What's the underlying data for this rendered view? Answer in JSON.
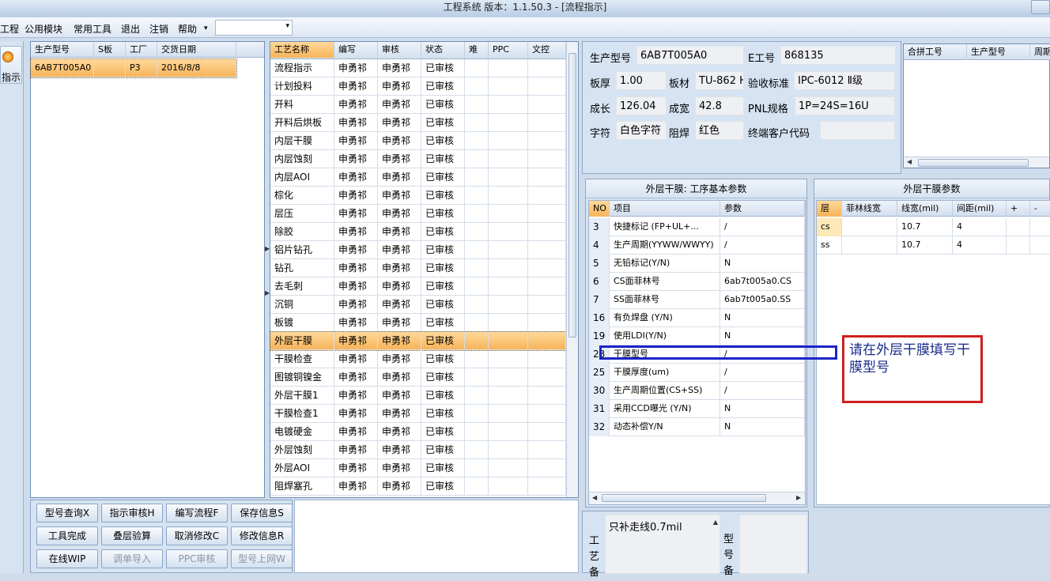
{
  "window": {
    "title": "工程系统   版本：1.1.50.3 - [流程指示]"
  },
  "menu": {
    "items": [
      "工程",
      "公用模块",
      "常用工具",
      "退出",
      "注销",
      "帮助"
    ],
    "help_arrow": "▾",
    "combo_value": "",
    "combo_arrow": "▾"
  },
  "left_strip": {
    "button_label": "指示"
  },
  "orders": {
    "headers": [
      "生产型号",
      "S板",
      "工厂",
      "交货日期"
    ],
    "rows": [
      [
        "6AB7T005A0",
        "",
        "P3",
        "2016/8/8"
      ]
    ]
  },
  "process": {
    "headers": [
      "工艺名称",
      "编写",
      "审核",
      "状态",
      "难",
      "PPC",
      "文控"
    ],
    "rows": [
      [
        "流程指示",
        "申勇祁",
        "申勇祁",
        "已审核"
      ],
      [
        "计划投料",
        "申勇祁",
        "申勇祁",
        "已审核"
      ],
      [
        "开料",
        "申勇祁",
        "申勇祁",
        "已审核"
      ],
      [
        "开料后烘板",
        "申勇祁",
        "申勇祁",
        "已审核"
      ],
      [
        "内层干膜",
        "申勇祁",
        "申勇祁",
        "已审核"
      ],
      [
        "内层蚀刻",
        "申勇祁",
        "申勇祁",
        "已审核"
      ],
      [
        "内层AOI",
        "申勇祁",
        "申勇祁",
        "已审核"
      ],
      [
        "棕化",
        "申勇祁",
        "申勇祁",
        "已审核"
      ],
      [
        "层压",
        "申勇祁",
        "申勇祁",
        "已审核"
      ],
      [
        "除胶",
        "申勇祁",
        "申勇祁",
        "已审核"
      ],
      [
        "铝片钻孔",
        "申勇祁",
        "申勇祁",
        "已审核"
      ],
      [
        "钻孔",
        "申勇祁",
        "申勇祁",
        "已审核"
      ],
      [
        "去毛刺",
        "申勇祁",
        "申勇祁",
        "已审核"
      ],
      [
        "沉铜",
        "申勇祁",
        "申勇祁",
        "已审核"
      ],
      [
        "板镀",
        "申勇祁",
        "申勇祁",
        "已审核"
      ],
      [
        "外层干膜",
        "申勇祁",
        "申勇祁",
        "已审核"
      ],
      [
        "干膜检查",
        "申勇祁",
        "申勇祁",
        "已审核"
      ],
      [
        "图镀铜镍金",
        "申勇祁",
        "申勇祁",
        "已审核"
      ],
      [
        "外层干膜1",
        "申勇祁",
        "申勇祁",
        "已审核"
      ],
      [
        "干膜检查1",
        "申勇祁",
        "申勇祁",
        "已审核"
      ],
      [
        "电镀硬金",
        "申勇祁",
        "申勇祁",
        "已审核"
      ],
      [
        "外层蚀刻",
        "申勇祁",
        "申勇祁",
        "已审核"
      ],
      [
        "外层AOI",
        "申勇祁",
        "申勇祁",
        "已审核"
      ],
      [
        "阻焊塞孔",
        "申勇祁",
        "申勇祁",
        "已审核"
      ]
    ],
    "selected_index": 15
  },
  "info": {
    "model_label": "生产型号",
    "model_value": "6AB7T005A0",
    "e_label": "E工号",
    "e_value": "868135",
    "thickness_label": "板厚",
    "thickness_value": "1.00",
    "material_label": "板材",
    "material_value": "TU-862 H",
    "standard_label": "验收标准",
    "standard_value": "IPC-6012 Ⅱ级",
    "length_label": "成长",
    "length_value": "126.04",
    "width_label": "成宽",
    "width_value": "42.8",
    "pnl_label": "PNL规格",
    "pnl_value": "1P=24S=16U",
    "char_label": "字符",
    "char_value": "白色字符",
    "mask_label": "阻焊",
    "mask_value": "红色",
    "customer_label": "终端客户代码",
    "customer_value": ""
  },
  "merge": {
    "headers": [
      "合拼工号",
      "生产型号",
      "周期"
    ]
  },
  "basic_params": {
    "title": "外层干膜: 工序基本参数",
    "headers": [
      "NO",
      "项目",
      "参数"
    ],
    "rows": [
      [
        "3",
        "快捷标记 (FP+UL+...",
        "/"
      ],
      [
        "4",
        "生产周期(YYWW/WWYY)",
        "/"
      ],
      [
        "5",
        "无铅标记(Y/N)",
        "N"
      ],
      [
        "6",
        "CS面菲林号",
        "6ab7t005a0.CS"
      ],
      [
        "7",
        "SS面菲林号",
        "6ab7t005a0.SS"
      ],
      [
        "16",
        "有负焊盘 (Y/N)",
        "N"
      ],
      [
        "19",
        "使用LDI(Y/N)",
        "N"
      ],
      [
        "23",
        "干膜型号",
        "/"
      ],
      [
        "25",
        "干膜厚度(um)",
        "/"
      ],
      [
        "30",
        "生产周期位置(CS+SS)",
        "/"
      ],
      [
        "31",
        "采用CCD曝光 (Y/N)",
        "N"
      ],
      [
        "32",
        "动态补偿Y/N",
        "N"
      ]
    ]
  },
  "film_params": {
    "title": "外层干膜参数",
    "headers": [
      "层",
      "菲林线宽",
      "线宽(mil)",
      "间距(mil)",
      "+",
      "-"
    ],
    "rows": [
      [
        "cs",
        "",
        "10.7",
        "4"
      ],
      [
        "ss",
        "",
        "10.7",
        "4"
      ]
    ]
  },
  "buttons": {
    "row1": [
      "型号查询X",
      "指示审核H",
      "编写流程F",
      "保存信息S"
    ],
    "row2": [
      "工具完成",
      "叠层验算",
      "取消修改C",
      "修改信息R"
    ],
    "row3": [
      "在线WIP",
      "调单导入",
      "PPC审核",
      "型号上网W"
    ]
  },
  "notes": {
    "process_label": "工艺备",
    "process_text": "只补走线0.7mil",
    "model_label": "型号备"
  },
  "annotation": {
    "text": "请在外层干膜填写干膜型号"
  },
  "colors": {
    "selection": "#f7b45a",
    "annotation_border": "#cf2020",
    "highlight_border": "#1a24c8"
  }
}
